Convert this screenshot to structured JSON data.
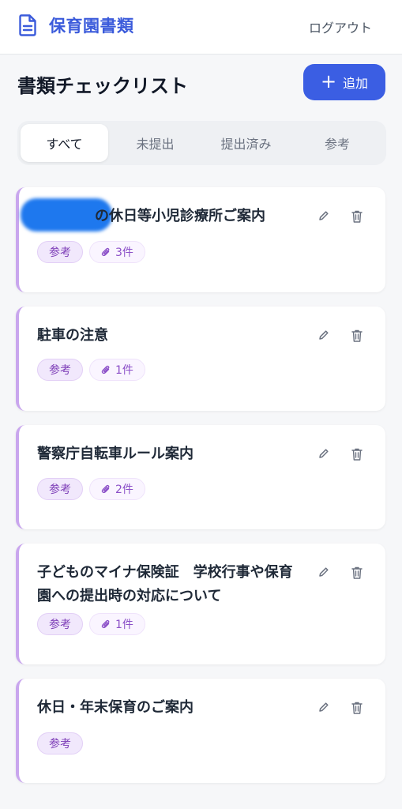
{
  "header": {
    "brand_icon": "document-icon",
    "title": "保育園書類",
    "logout_label": "ログアウト"
  },
  "page": {
    "title": "書類チェックリスト",
    "add_label": "追加",
    "accent_color": "#3b5ee3"
  },
  "tabs": [
    {
      "label": "すべて",
      "active": true
    },
    {
      "label": "未提出",
      "active": false
    },
    {
      "label": "提出済み",
      "active": false
    },
    {
      "label": "参考",
      "active": false
    }
  ],
  "documents": [
    {
      "title": "の休日等小児診療所ご案内",
      "category": "参考",
      "attachments": "3件"
    },
    {
      "title": "駐車の注意",
      "category": "参考",
      "attachments": "1件"
    },
    {
      "title": "警察庁自転車ルール案内",
      "category": "参考",
      "attachments": "2件"
    },
    {
      "title": "子どものマイナ保険証　学校行事や保育園への提出時の対応について",
      "category": "参考",
      "attachments": "1件"
    },
    {
      "title": "休日・年末保育のご案内",
      "category": "参考",
      "attachments": ""
    }
  ],
  "colors": {
    "category_accent": "#c9a6ee",
    "badge_text": "#7e3fb8"
  }
}
